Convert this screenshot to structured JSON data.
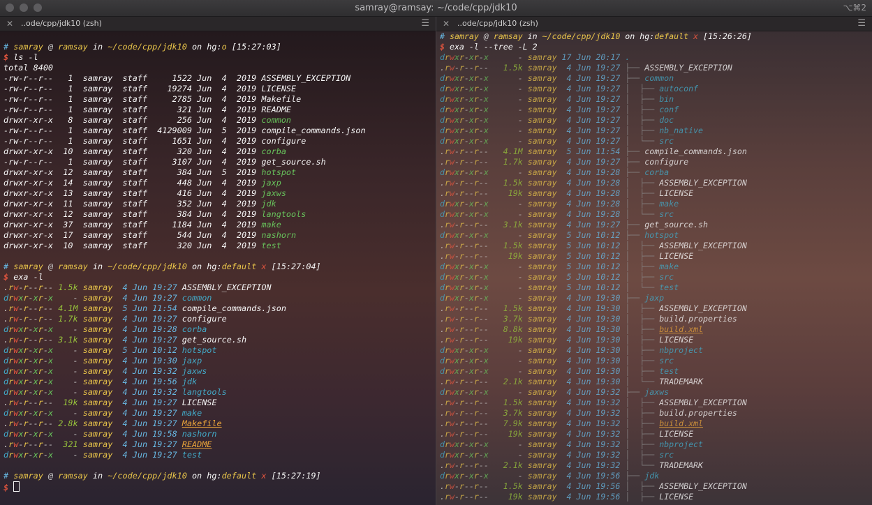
{
  "window": {
    "title": "samray@ramsay: ~/code/cpp/jdk10",
    "shortcut": "⌥⌘2",
    "traffic_lights": [
      "close",
      "minimize",
      "zoom"
    ]
  },
  "tabs": {
    "left": {
      "label": "..ode/cpp/jdk10 (zsh)"
    },
    "right": {
      "label": "..ode/cpp/jdk10 (zsh)"
    }
  },
  "left_pane": {
    "prompt1": {
      "hash": "#",
      "user": "samray",
      "at": "@",
      "host": "ramsay",
      "in": "in",
      "path": "~/code/cpp/jdk10",
      "on": "on",
      "hg": "hg:",
      "branch": "o",
      "x": "",
      "time": "[15:27:03]"
    },
    "cmd1": {
      "dollar": "$",
      "text": "ls -l"
    },
    "ls_total": "total 8400",
    "ls_rows": [
      {
        "perm": "-rw-r--r--",
        "links": "1",
        "user": "samray",
        "group": "staff",
        "size": "1522",
        "mon": "Jun",
        "day": "4",
        "year": "2019",
        "name": "ASSEMBLY_EXCEPTION",
        "kind": "file"
      },
      {
        "perm": "-rw-r--r--",
        "links": "1",
        "user": "samray",
        "group": "staff",
        "size": "19274",
        "mon": "Jun",
        "day": "4",
        "year": "2019",
        "name": "LICENSE",
        "kind": "file"
      },
      {
        "perm": "-rw-r--r--",
        "links": "1",
        "user": "samray",
        "group": "staff",
        "size": "2785",
        "mon": "Jun",
        "day": "4",
        "year": "2019",
        "name": "Makefile",
        "kind": "file"
      },
      {
        "perm": "-rw-r--r--",
        "links": "1",
        "user": "samray",
        "group": "staff",
        "size": "321",
        "mon": "Jun",
        "day": "4",
        "year": "2019",
        "name": "README",
        "kind": "file"
      },
      {
        "perm": "drwxr-xr-x",
        "links": "8",
        "user": "samray",
        "group": "staff",
        "size": "256",
        "mon": "Jun",
        "day": "4",
        "year": "2019",
        "name": "common",
        "kind": "dir"
      },
      {
        "perm": "-rw-r--r--",
        "links": "1",
        "user": "samray",
        "group": "staff",
        "size": "4129009",
        "mon": "Jun",
        "day": "5",
        "year": "2019",
        "name": "compile_commands.json",
        "kind": "file"
      },
      {
        "perm": "-rw-r--r--",
        "links": "1",
        "user": "samray",
        "group": "staff",
        "size": "1651",
        "mon": "Jun",
        "day": "4",
        "year": "2019",
        "name": "configure",
        "kind": "file"
      },
      {
        "perm": "drwxr-xr-x",
        "links": "10",
        "user": "samray",
        "group": "staff",
        "size": "320",
        "mon": "Jun",
        "day": "4",
        "year": "2019",
        "name": "corba",
        "kind": "dir"
      },
      {
        "perm": "-rw-r--r--",
        "links": "1",
        "user": "samray",
        "group": "staff",
        "size": "3107",
        "mon": "Jun",
        "day": "4",
        "year": "2019",
        "name": "get_source.sh",
        "kind": "file"
      },
      {
        "perm": "drwxr-xr-x",
        "links": "12",
        "user": "samray",
        "group": "staff",
        "size": "384",
        "mon": "Jun",
        "day": "5",
        "year": "2019",
        "name": "hotspot",
        "kind": "dir"
      },
      {
        "perm": "drwxr-xr-x",
        "links": "14",
        "user": "samray",
        "group": "staff",
        "size": "448",
        "mon": "Jun",
        "day": "4",
        "year": "2019",
        "name": "jaxp",
        "kind": "dir"
      },
      {
        "perm": "drwxr-xr-x",
        "links": "13",
        "user": "samray",
        "group": "staff",
        "size": "416",
        "mon": "Jun",
        "day": "4",
        "year": "2019",
        "name": "jaxws",
        "kind": "dir"
      },
      {
        "perm": "drwxr-xr-x",
        "links": "11",
        "user": "samray",
        "group": "staff",
        "size": "352",
        "mon": "Jun",
        "day": "4",
        "year": "2019",
        "name": "jdk",
        "kind": "dir"
      },
      {
        "perm": "drwxr-xr-x",
        "links": "12",
        "user": "samray",
        "group": "staff",
        "size": "384",
        "mon": "Jun",
        "day": "4",
        "year": "2019",
        "name": "langtools",
        "kind": "dir"
      },
      {
        "perm": "drwxr-xr-x",
        "links": "37",
        "user": "samray",
        "group": "staff",
        "size": "1184",
        "mon": "Jun",
        "day": "4",
        "year": "2019",
        "name": "make",
        "kind": "dir"
      },
      {
        "perm": "drwxr-xr-x",
        "links": "17",
        "user": "samray",
        "group": "staff",
        "size": "544",
        "mon": "Jun",
        "day": "4",
        "year": "2019",
        "name": "nashorn",
        "kind": "dir"
      },
      {
        "perm": "drwxr-xr-x",
        "links": "10",
        "user": "samray",
        "group": "staff",
        "size": "320",
        "mon": "Jun",
        "day": "4",
        "year": "2019",
        "name": "test",
        "kind": "dir"
      }
    ],
    "prompt2": {
      "hash": "#",
      "user": "samray",
      "at": "@",
      "host": "ramsay",
      "in": "in",
      "path": "~/code/cpp/jdk10",
      "on": "on",
      "hg": "hg:",
      "branch": "default",
      "x": "x",
      "time": "[15:27:04]"
    },
    "cmd2": {
      "dollar": "$",
      "text": "exa -l"
    },
    "exa_rows": [
      {
        "perm": ".rw-r--r--",
        "size": "1.5k",
        "user": "samray",
        "date": "4 Jun 19:27",
        "name": "ASSEMBLY_EXCEPTION",
        "kind": "file"
      },
      {
        "perm": "drwxr-xr-x",
        "size": "-",
        "user": "samray",
        "date": "4 Jun 19:27",
        "name": "common",
        "kind": "dir"
      },
      {
        "perm": ".rw-r--r--",
        "size": "4.1M",
        "user": "samray",
        "date": "5 Jun 11:54",
        "name": "compile_commands.json",
        "kind": "file"
      },
      {
        "perm": ".rw-r--r--",
        "size": "1.7k",
        "user": "samray",
        "date": "4 Jun 19:27",
        "name": "configure",
        "kind": "file"
      },
      {
        "perm": "drwxr-xr-x",
        "size": "-",
        "user": "samray",
        "date": "4 Jun 19:28",
        "name": "corba",
        "kind": "dir"
      },
      {
        "perm": ".rw-r--r--",
        "size": "3.1k",
        "user": "samray",
        "date": "4 Jun 19:27",
        "name": "get_source.sh",
        "kind": "file"
      },
      {
        "perm": "drwxr-xr-x",
        "size": "-",
        "user": "samray",
        "date": "5 Jun 10:12",
        "name": "hotspot",
        "kind": "dir"
      },
      {
        "perm": "drwxr-xr-x",
        "size": "-",
        "user": "samray",
        "date": "4 Jun 19:30",
        "name": "jaxp",
        "kind": "dir"
      },
      {
        "perm": "drwxr-xr-x",
        "size": "-",
        "user": "samray",
        "date": "4 Jun 19:32",
        "name": "jaxws",
        "kind": "dir"
      },
      {
        "perm": "drwxr-xr-x",
        "size": "-",
        "user": "samray",
        "date": "4 Jun 19:56",
        "name": "jdk",
        "kind": "dir"
      },
      {
        "perm": "drwxr-xr-x",
        "size": "-",
        "user": "samray",
        "date": "4 Jun 19:32",
        "name": "langtools",
        "kind": "dir"
      },
      {
        "perm": ".rw-r--r--",
        "size": "19k",
        "user": "samray",
        "date": "4 Jun 19:27",
        "name": "LICENSE",
        "kind": "file"
      },
      {
        "perm": "drwxr-xr-x",
        "size": "-",
        "user": "samray",
        "date": "4 Jun 19:27",
        "name": "make",
        "kind": "dir"
      },
      {
        "perm": ".rw-r--r--",
        "size": "2.8k",
        "user": "samray",
        "date": "4 Jun 19:27",
        "name": "Makefile",
        "kind": "special"
      },
      {
        "perm": "drwxr-xr-x",
        "size": "-",
        "user": "samray",
        "date": "4 Jun 19:58",
        "name": "nashorn",
        "kind": "dir"
      },
      {
        "perm": ".rw-r--r--",
        "size": "321",
        "user": "samray",
        "date": "4 Jun 19:27",
        "name": "README",
        "kind": "special"
      },
      {
        "perm": "drwxr-xr-x",
        "size": "-",
        "user": "samray",
        "date": "4 Jun 19:27",
        "name": "test",
        "kind": "dir"
      }
    ],
    "prompt3": {
      "hash": "#",
      "user": "samray",
      "at": "@",
      "host": "ramsay",
      "in": "in",
      "path": "~/code/cpp/jdk10",
      "on": "on",
      "hg": "hg:",
      "branch": "default",
      "x": "x",
      "time": "[15:27:19]"
    },
    "cmd3": {
      "dollar": "$",
      "text": ""
    }
  },
  "right_pane": {
    "prompt1": {
      "hash": "#",
      "user": "samray",
      "at": "@",
      "host": "ramsay",
      "in": "in",
      "path": "~/code/cpp/jdk10",
      "on": "on",
      "hg": "hg:",
      "branch": "default",
      "x": "x",
      "time": "[15:26:26]"
    },
    "cmd1": {
      "dollar": "$",
      "text": "exa -l --tree -L 2"
    },
    "tree_rows": [
      {
        "perm": "drwxr-xr-x",
        "size": "-",
        "user": "samray",
        "date": "17 Jun 20:17",
        "prefix": "",
        "name": ".",
        "kind": "dir"
      },
      {
        "perm": ".rw-r--r--",
        "size": "1.5k",
        "user": "samray",
        "date": "4 Jun 19:27",
        "prefix": "├── ",
        "name": "ASSEMBLY_EXCEPTION",
        "kind": "file"
      },
      {
        "perm": "drwxr-xr-x",
        "size": "-",
        "user": "samray",
        "date": "4 Jun 19:27",
        "prefix": "├── ",
        "name": "common",
        "kind": "dir"
      },
      {
        "perm": "drwxr-xr-x",
        "size": "-",
        "user": "samray",
        "date": "4 Jun 19:27",
        "prefix": "│  ├── ",
        "name": "autoconf",
        "kind": "dir"
      },
      {
        "perm": "drwxr-xr-x",
        "size": "-",
        "user": "samray",
        "date": "4 Jun 19:27",
        "prefix": "│  ├── ",
        "name": "bin",
        "kind": "dir"
      },
      {
        "perm": "drwxr-xr-x",
        "size": "-",
        "user": "samray",
        "date": "4 Jun 19:27",
        "prefix": "│  ├── ",
        "name": "conf",
        "kind": "dir"
      },
      {
        "perm": "drwxr-xr-x",
        "size": "-",
        "user": "samray",
        "date": "4 Jun 19:27",
        "prefix": "│  ├── ",
        "name": "doc",
        "kind": "dir"
      },
      {
        "perm": "drwxr-xr-x",
        "size": "-",
        "user": "samray",
        "date": "4 Jun 19:27",
        "prefix": "│  ├── ",
        "name": "nb_native",
        "kind": "dir"
      },
      {
        "perm": "drwxr-xr-x",
        "size": "-",
        "user": "samray",
        "date": "4 Jun 19:27",
        "prefix": "│  └── ",
        "name": "src",
        "kind": "dir"
      },
      {
        "perm": ".rw-r--r--",
        "size": "4.1M",
        "user": "samray",
        "date": "5 Jun 11:54",
        "prefix": "├── ",
        "name": "compile_commands.json",
        "kind": "file"
      },
      {
        "perm": ".rw-r--r--",
        "size": "1.7k",
        "user": "samray",
        "date": "4 Jun 19:27",
        "prefix": "├── ",
        "name": "configure",
        "kind": "file"
      },
      {
        "perm": "drwxr-xr-x",
        "size": "-",
        "user": "samray",
        "date": "4 Jun 19:28",
        "prefix": "├── ",
        "name": "corba",
        "kind": "dir"
      },
      {
        "perm": ".rw-r--r--",
        "size": "1.5k",
        "user": "samray",
        "date": "4 Jun 19:28",
        "prefix": "│  ├── ",
        "name": "ASSEMBLY_EXCEPTION",
        "kind": "file"
      },
      {
        "perm": ".rw-r--r--",
        "size": "19k",
        "user": "samray",
        "date": "4 Jun 19:28",
        "prefix": "│  ├── ",
        "name": "LICENSE",
        "kind": "file"
      },
      {
        "perm": "drwxr-xr-x",
        "size": "-",
        "user": "samray",
        "date": "4 Jun 19:28",
        "prefix": "│  ├── ",
        "name": "make",
        "kind": "dir"
      },
      {
        "perm": "drwxr-xr-x",
        "size": "-",
        "user": "samray",
        "date": "4 Jun 19:28",
        "prefix": "│  └── ",
        "name": "src",
        "kind": "dir"
      },
      {
        "perm": ".rw-r--r--",
        "size": "3.1k",
        "user": "samray",
        "date": "4 Jun 19:27",
        "prefix": "├── ",
        "name": "get_source.sh",
        "kind": "file"
      },
      {
        "perm": "drwxr-xr-x",
        "size": "-",
        "user": "samray",
        "date": "5 Jun 10:12",
        "prefix": "├── ",
        "name": "hotspot",
        "kind": "dir"
      },
      {
        "perm": ".rw-r--r--",
        "size": "1.5k",
        "user": "samray",
        "date": "5 Jun 10:12",
        "prefix": "│  ├── ",
        "name": "ASSEMBLY_EXCEPTION",
        "kind": "file"
      },
      {
        "perm": ".rw-r--r--",
        "size": "19k",
        "user": "samray",
        "date": "5 Jun 10:12",
        "prefix": "│  ├── ",
        "name": "LICENSE",
        "kind": "file"
      },
      {
        "perm": "drwxr-xr-x",
        "size": "-",
        "user": "samray",
        "date": "5 Jun 10:12",
        "prefix": "│  ├── ",
        "name": "make",
        "kind": "dir"
      },
      {
        "perm": "drwxr-xr-x",
        "size": "-",
        "user": "samray",
        "date": "5 Jun 10:12",
        "prefix": "│  ├── ",
        "name": "src",
        "kind": "dir"
      },
      {
        "perm": "drwxr-xr-x",
        "size": "-",
        "user": "samray",
        "date": "5 Jun 10:12",
        "prefix": "│  └── ",
        "name": "test",
        "kind": "dir"
      },
      {
        "perm": "drwxr-xr-x",
        "size": "-",
        "user": "samray",
        "date": "4 Jun 19:30",
        "prefix": "├── ",
        "name": "jaxp",
        "kind": "dir"
      },
      {
        "perm": ".rw-r--r--",
        "size": "1.5k",
        "user": "samray",
        "date": "4 Jun 19:30",
        "prefix": "│  ├── ",
        "name": "ASSEMBLY_EXCEPTION",
        "kind": "file"
      },
      {
        "perm": ".rw-r--r--",
        "size": "3.7k",
        "user": "samray",
        "date": "4 Jun 19:30",
        "prefix": "│  ├── ",
        "name": "build.properties",
        "kind": "file"
      },
      {
        "perm": ".rw-r--r--",
        "size": "8.8k",
        "user": "samray",
        "date": "4 Jun 19:30",
        "prefix": "│  ├── ",
        "name": "build.xml",
        "kind": "special"
      },
      {
        "perm": ".rw-r--r--",
        "size": "19k",
        "user": "samray",
        "date": "4 Jun 19:30",
        "prefix": "│  ├── ",
        "name": "LICENSE",
        "kind": "file"
      },
      {
        "perm": "drwxr-xr-x",
        "size": "-",
        "user": "samray",
        "date": "4 Jun 19:30",
        "prefix": "│  ├── ",
        "name": "nbproject",
        "kind": "dir"
      },
      {
        "perm": "drwxr-xr-x",
        "size": "-",
        "user": "samray",
        "date": "4 Jun 19:30",
        "prefix": "│  ├── ",
        "name": "src",
        "kind": "dir"
      },
      {
        "perm": "drwxr-xr-x",
        "size": "-",
        "user": "samray",
        "date": "4 Jun 19:30",
        "prefix": "│  ├── ",
        "name": "test",
        "kind": "dir"
      },
      {
        "perm": ".rw-r--r--",
        "size": "2.1k",
        "user": "samray",
        "date": "4 Jun 19:30",
        "prefix": "│  └── ",
        "name": "TRADEMARK",
        "kind": "file"
      },
      {
        "perm": "drwxr-xr-x",
        "size": "-",
        "user": "samray",
        "date": "4 Jun 19:32",
        "prefix": "├── ",
        "name": "jaxws",
        "kind": "dir"
      },
      {
        "perm": ".rw-r--r--",
        "size": "1.5k",
        "user": "samray",
        "date": "4 Jun 19:32",
        "prefix": "│  ├── ",
        "name": "ASSEMBLY_EXCEPTION",
        "kind": "file"
      },
      {
        "perm": ".rw-r--r--",
        "size": "3.7k",
        "user": "samray",
        "date": "4 Jun 19:32",
        "prefix": "│  ├── ",
        "name": "build.properties",
        "kind": "file"
      },
      {
        "perm": ".rw-r--r--",
        "size": "7.9k",
        "user": "samray",
        "date": "4 Jun 19:32",
        "prefix": "│  ├── ",
        "name": "build.xml",
        "kind": "special"
      },
      {
        "perm": ".rw-r--r--",
        "size": "19k",
        "user": "samray",
        "date": "4 Jun 19:32",
        "prefix": "│  ├── ",
        "name": "LICENSE",
        "kind": "file"
      },
      {
        "perm": "drwxr-xr-x",
        "size": "-",
        "user": "samray",
        "date": "4 Jun 19:32",
        "prefix": "│  ├── ",
        "name": "nbproject",
        "kind": "dir"
      },
      {
        "perm": "drwxr-xr-x",
        "size": "-",
        "user": "samray",
        "date": "4 Jun 19:32",
        "prefix": "│  ├── ",
        "name": "src",
        "kind": "dir"
      },
      {
        "perm": ".rw-r--r--",
        "size": "2.1k",
        "user": "samray",
        "date": "4 Jun 19:32",
        "prefix": "│  └── ",
        "name": "TRADEMARK",
        "kind": "file"
      },
      {
        "perm": "drwxr-xr-x",
        "size": "-",
        "user": "samray",
        "date": "4 Jun 19:56",
        "prefix": "├── ",
        "name": "jdk",
        "kind": "dir"
      },
      {
        "perm": ".rw-r--r--",
        "size": "1.5k",
        "user": "samray",
        "date": "4 Jun 19:56",
        "prefix": "│  ├── ",
        "name": "ASSEMBLY_EXCEPTION",
        "kind": "file"
      },
      {
        "perm": ".rw-r--r--",
        "size": "19k",
        "user": "samray",
        "date": "4 Jun 19:56",
        "prefix": "│  ├── ",
        "name": "LICENSE",
        "kind": "file"
      }
    ]
  },
  "colors": {
    "user": "#e8c44a",
    "path": "#e8c44a",
    "dir": "#42a9c7",
    "date": "#67b7e2",
    "size": "#96c13b",
    "dollar": "#e0543e",
    "special": "#e8a33a"
  }
}
